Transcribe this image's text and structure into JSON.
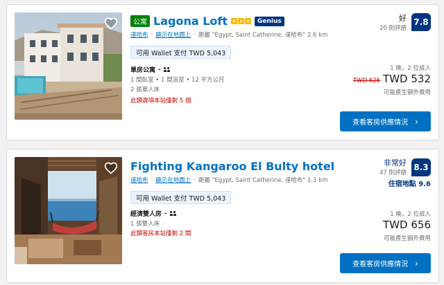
{
  "listings": [
    {
      "property_type": "公寓",
      "name": "Lagona Loft",
      "star_count": 3,
      "genius_label": "Genius",
      "location": {
        "city_link": "達哈布",
        "map_link": "顯示在地圖上",
        "distance_text": "距離 \"Egypt, Saint Catherine, 達哈布\" 2.6 km"
      },
      "wallet_text": "可用 Wallet 支付 TWD 5,043",
      "room": {
        "title": "單房公寓",
        "separator": "-",
        "details": "1 間臥室 • 1 間浴室 • 12 平方公尺",
        "beds": "2 張單人床"
      },
      "scarcity": "此類選項本站僅剩 5 個",
      "rating": {
        "word": "好",
        "reviews": "20 則評語",
        "score": "7.8"
      },
      "occupancy": "1 晚，2 位成人",
      "old_price": "TWD 626",
      "price": "TWD 532",
      "tax_note": "可能產生額外費用",
      "cta_label": "查看客房供應情況",
      "cta_icon": "chevron-right",
      "colors": {
        "badge": "#008009",
        "star": "#febb02",
        "scarcity": "#cc0000"
      }
    },
    {
      "name": "Fighting Kangaroo El Bulty hotel",
      "location": {
        "city_link": "達哈布",
        "map_link": "顯示在地圖上",
        "distance_text": "距離 \"Egypt, Saint Catherine, 達哈布\" 1.3 km"
      },
      "wallet_text": "可用 Wallet 支付 TWD 5,043",
      "room": {
        "title": "經濟雙人房",
        "separator": "-",
        "beds": "1 張雙人床"
      },
      "scarcity": "此類客房本站僅剩 2 間",
      "rating": {
        "word": "非常好",
        "reviews": "47 則評語",
        "score": "8.3",
        "location_score": "住宿地點 9.6"
      },
      "occupancy": "1 晚，2 位成人",
      "price": "TWD 656",
      "tax_note": "可能產生額外費用",
      "cta_label": "查看客房供應情況",
      "cta_icon": "chevron-right"
    }
  ],
  "theme": {
    "primary": "#0071c2",
    "dark_blue": "#003580",
    "wallet_bg": "#ebf3ff"
  }
}
